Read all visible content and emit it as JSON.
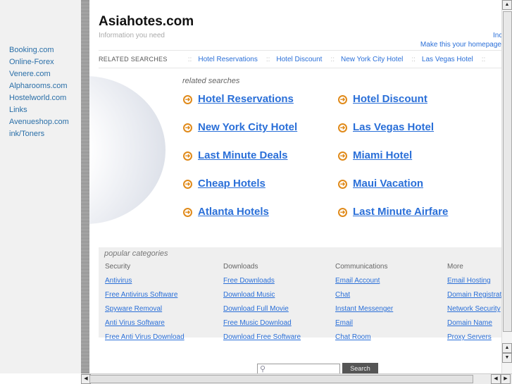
{
  "sidebar": {
    "links": [
      "Booking.com",
      "Online-Forex",
      "Venere.com",
      "Alpharooms.com",
      "Hostelworld.com",
      "Links",
      "Avenueshop.com",
      "ink/Toners"
    ]
  },
  "header": {
    "title": "Asiahotes.com",
    "tagline": "Information you need",
    "top_link": "Inc",
    "homepage": "Make this your homepage"
  },
  "related_bar": {
    "label": "RELATED SEARCHES",
    "links": [
      "Hotel Reservations",
      "Hotel Discount",
      "New York City Hotel",
      "Las Vegas Hotel"
    ]
  },
  "related": {
    "heading": "related searches",
    "left": [
      "Hotel Reservations",
      "New York City Hotel",
      "Last Minute Deals",
      "Cheap Hotels",
      "Atlanta Hotels"
    ],
    "right": [
      "Hotel Discount",
      "Las Vegas Hotel",
      "Miami Hotel",
      "Maui Vacation",
      "Last Minute Airfare"
    ]
  },
  "popular": {
    "heading": "popular categories",
    "columns": [
      {
        "title": "Security",
        "links": [
          "Antivirus",
          "Free Antivirus Software",
          "Spyware Removal",
          "Anti Virus Software",
          "Free Anti Virus Download"
        ]
      },
      {
        "title": "Downloads",
        "links": [
          "Free Downloads",
          "Download Music",
          "Download Full Movie",
          "Free Music Download",
          "Download Free Software"
        ]
      },
      {
        "title": "Communications",
        "links": [
          "Email Account",
          "Chat",
          "Instant Messenger",
          "Email",
          "Chat Room"
        ]
      },
      {
        "title": "More",
        "links": [
          "Email Hosting",
          "Domain Registration",
          "Network Security",
          "Domain Name",
          "Proxy Servers"
        ]
      }
    ]
  },
  "search": {
    "button": "Search",
    "value": ""
  }
}
